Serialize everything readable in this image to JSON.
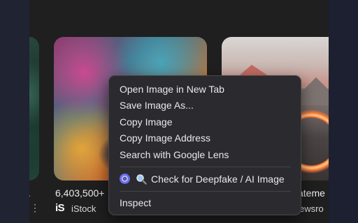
{
  "results": [
    {
      "caption": "",
      "source": ""
    },
    {
      "caption": "6,403,500+",
      "source": "iStock",
      "logo": "iS"
    },
    {
      "caption": "ateme",
      "source": "ewsro"
    }
  ],
  "more_options_glyph": "⋮",
  "leftmost_caption_fragment": ".",
  "context_menu": {
    "items": [
      "Open Image in New Tab",
      "Save Image As...",
      "Copy Image",
      "Copy Image Address",
      "Search with Google Lens"
    ],
    "extension_item": {
      "icon": "magnifying-glass-icon",
      "label": "Check for Deepfake / AI Image",
      "radio_color": "#6b6ee8"
    },
    "inspect_label": "Inspect"
  },
  "colors": {
    "page_background": "#1f1f1f",
    "menu_background": "#2b2a2e",
    "accent": "#6b6ee8"
  }
}
